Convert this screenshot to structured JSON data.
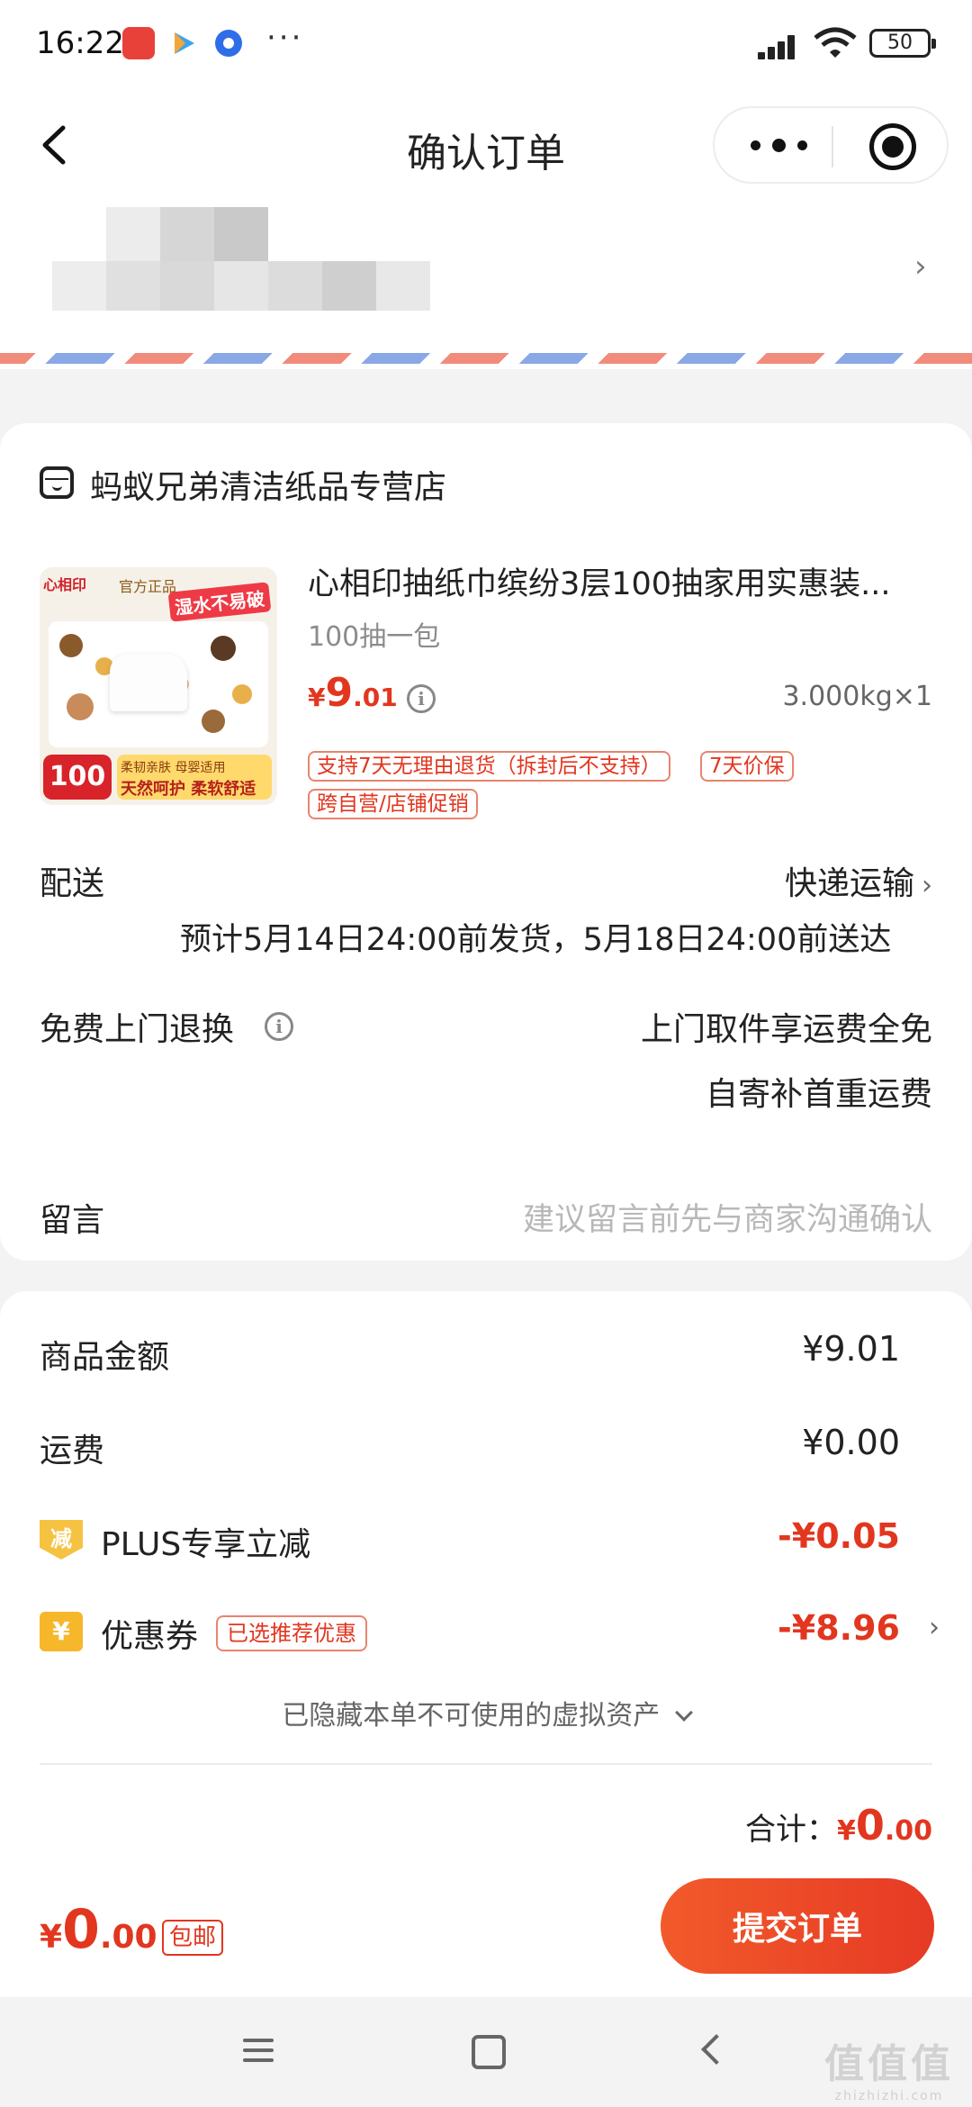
{
  "status_bar": {
    "time": "16:22",
    "overflow": "···",
    "battery": "50"
  },
  "nav": {
    "title": "确认订单",
    "back_icon": "back-arrow-icon",
    "more_icon": "more-dots-icon",
    "close_icon": "target-icon"
  },
  "address": {
    "chevron": "›",
    "redacted": true
  },
  "store": {
    "name": "蚂蚁兄弟清洁纸品专营店"
  },
  "product": {
    "image_texts": {
      "brand": "心相印",
      "official": "官方正品",
      "tag": "湿水不易破",
      "count": "100",
      "feature": "柔韧亲肤 母婴适用",
      "slogan": "天然呵护 柔软舒适"
    },
    "title": "心相印抽纸巾缤纷3层100抽家用实惠装...",
    "spec": "100抽一包",
    "price_symbol": "¥",
    "price_int": "9",
    "price_dec": ".01",
    "qty": "3.000kg×1",
    "tags": [
      "支持7天无理由退货（拆封后不支持）",
      "7天价保",
      "跨自营/店铺促销"
    ]
  },
  "delivery": {
    "label": "配送",
    "method": "快递运输",
    "estimate": "预计5月14日24:00前发货，5月18日24:00前送达"
  },
  "free_return": {
    "label": "免费上门退换",
    "line1": "上门取件享运费全免",
    "line2": "自寄补首重运费"
  },
  "message": {
    "label": "留言",
    "placeholder": "建议留言前先与商家沟通确认"
  },
  "summary": {
    "goods_label": "商品金额",
    "goods_value": "¥9.01",
    "shipping_label": "运费",
    "shipping_value": "¥0.00",
    "plus_icon_text": "减",
    "plus_label": "PLUS专享立减",
    "plus_value": "-¥0.05",
    "coupon_icon_text": "¥",
    "coupon_label": "优惠券",
    "coupon_tag": "已选推荐优惠",
    "coupon_value": "-¥8.96",
    "hidden_assets": "已隐藏本单不可使用的虚拟资产",
    "total_label": "合计：",
    "total_symbol": "¥",
    "total_int": "0",
    "total_dec": ".00"
  },
  "bottom": {
    "price_symbol": "¥",
    "price_int": "0",
    "price_dec": ".00",
    "badge": "包邮",
    "submit": "提交订单"
  },
  "watermark": {
    "big": "值值值",
    "small": "zhizhizhi.com"
  },
  "colors": {
    "accent_red": "#e2361f",
    "button_start": "#f25a2a",
    "button_end": "#e63a25",
    "coupon_yellow": "#f6b72b"
  }
}
